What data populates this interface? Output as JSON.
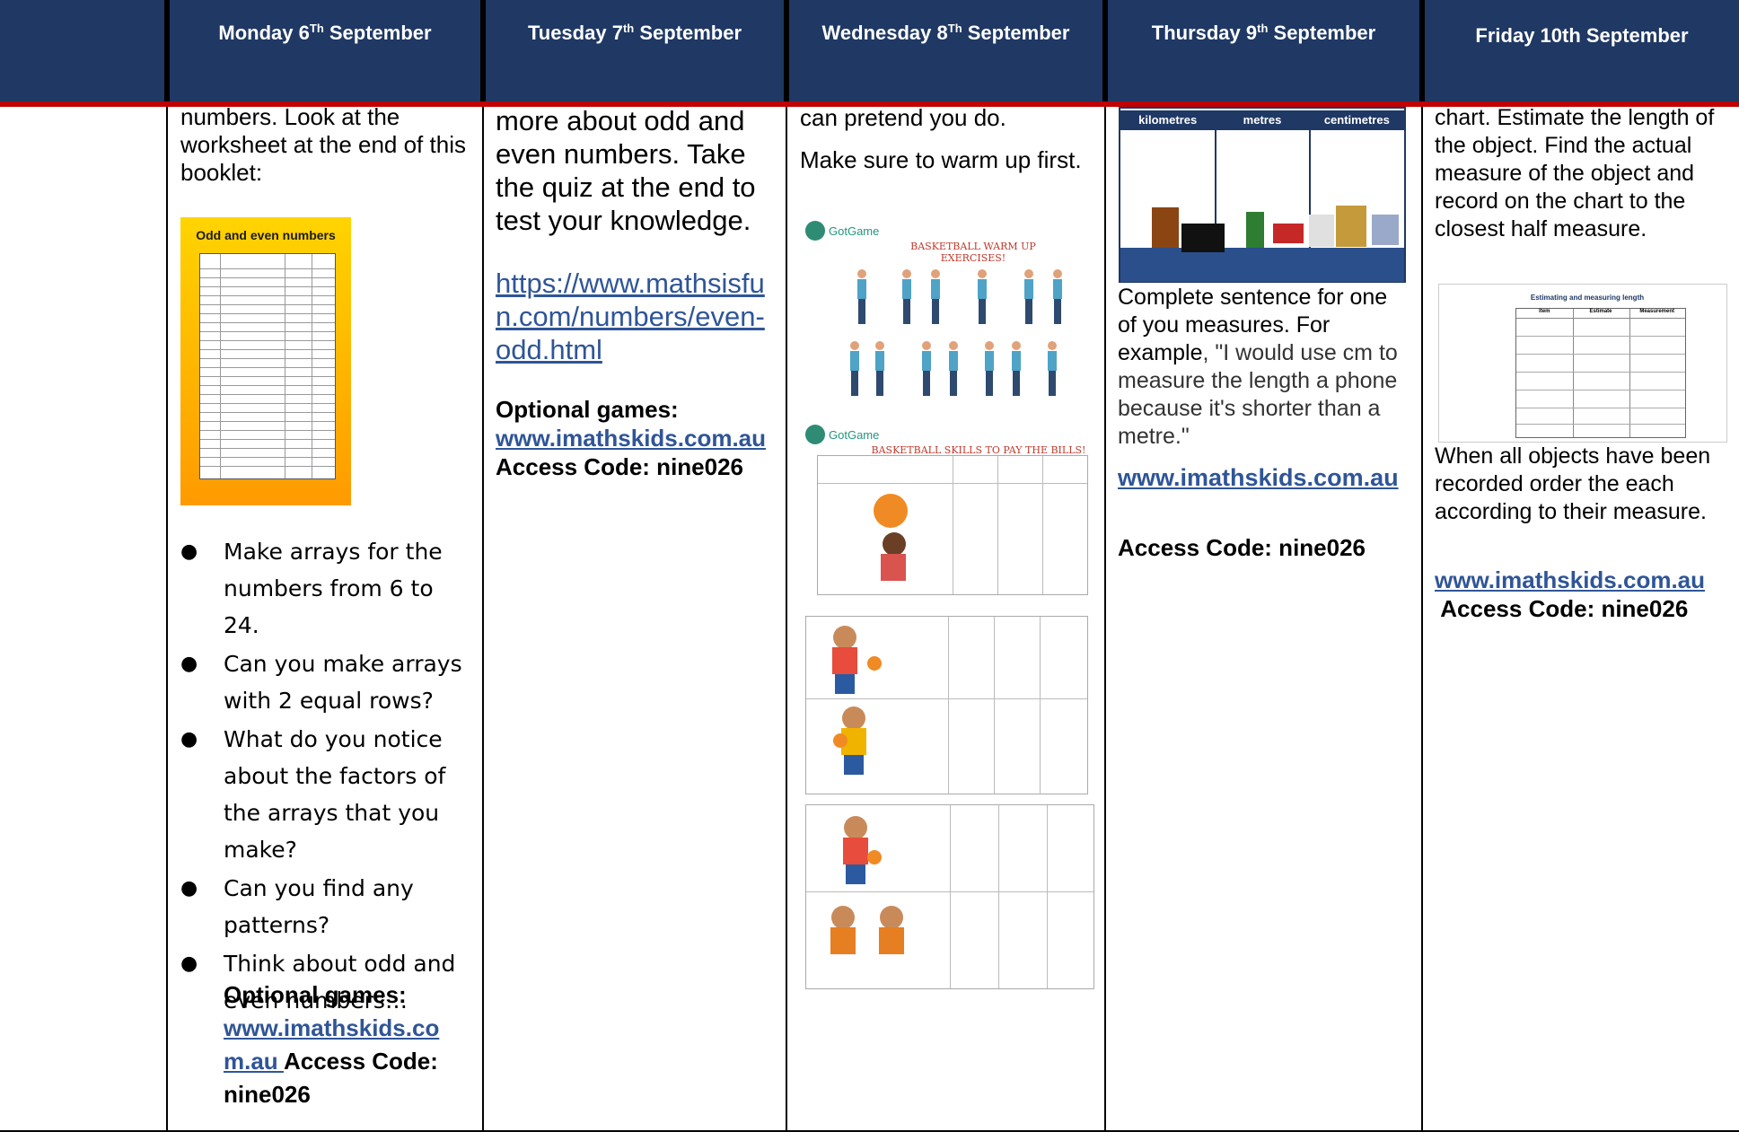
{
  "header": {
    "days": [
      {
        "name": "Monday 6",
        "sup": "Th",
        "rest": " September"
      },
      {
        "name": "Tuesday 7",
        "sup": "th",
        "rest": " September"
      },
      {
        "name": "Wednesday 8",
        "sup": "Th",
        "rest": " September"
      },
      {
        "name": "Thursday 9",
        "sup": "th",
        "rest": " September"
      },
      {
        "name": "Friday 10th September",
        "sup": "",
        "rest": ""
      }
    ]
  },
  "monday": {
    "intro": "numbers. Look at the worksheet at the end of this booklet:",
    "card_title": "Odd and even numbers",
    "bullets": [
      "Make arrays for the numbers from 6 to 24.",
      "Can you make arrays with 2 equal rows?",
      "What do you notice about the factors of the arrays that you make?",
      "Can you find any patterns?",
      "Think about odd and even numbers…"
    ],
    "optional_label": "Optional games:",
    "link": "www.imathskids.com.au ",
    "access": "Access Code: nine026"
  },
  "tuesday": {
    "intro": "more about odd and even numbers. Take the quiz at the end to test your knowledge.",
    "link": "https://www.mathsisfun.com/numbers/even-odd.html",
    "optional_label": "Optional games:",
    "games_link": "www.imathskids.com.au ",
    "access": "Access Code: nine026"
  },
  "wednesday": {
    "intro": "can pretend you do.",
    "warmup": "Make sure to warm up first.",
    "brand": "GotGame",
    "warmup_title": "BASKETBALL WARM UP EXERCISES!",
    "skills_title": "BASKETBALL SKILLS TO PAY THE BILLS!"
  },
  "thursday": {
    "units": [
      "kilometres",
      "metres",
      "centimetres"
    ],
    "sentence_1": "Complete sentence for one of you measures. For ",
    "sentence_2": "example",
    "sentence_3": ", \"I would use cm to measure the length a phone because it's shorter than a metre.\"",
    "link": "www.imathskids.com.au",
    "access": "Access Code: nine026"
  },
  "friday": {
    "intro": "chart. Estimate the length of the object. Find the actual measure of the object and record on the chart to the closest half measure.",
    "sheet_title": "Estimating and measuring length",
    "sheet_cols": [
      "Item",
      "Estimate",
      "Measurement"
    ],
    "after": "When all objects have been recorded order the each according to their measure.",
    "link": "www.imathskids.com.au",
    "access": "Access Code: nine026"
  },
  "colors": {
    "header_bg": "#1f3864",
    "accent_red": "#c00000",
    "link": "#2f5597"
  }
}
